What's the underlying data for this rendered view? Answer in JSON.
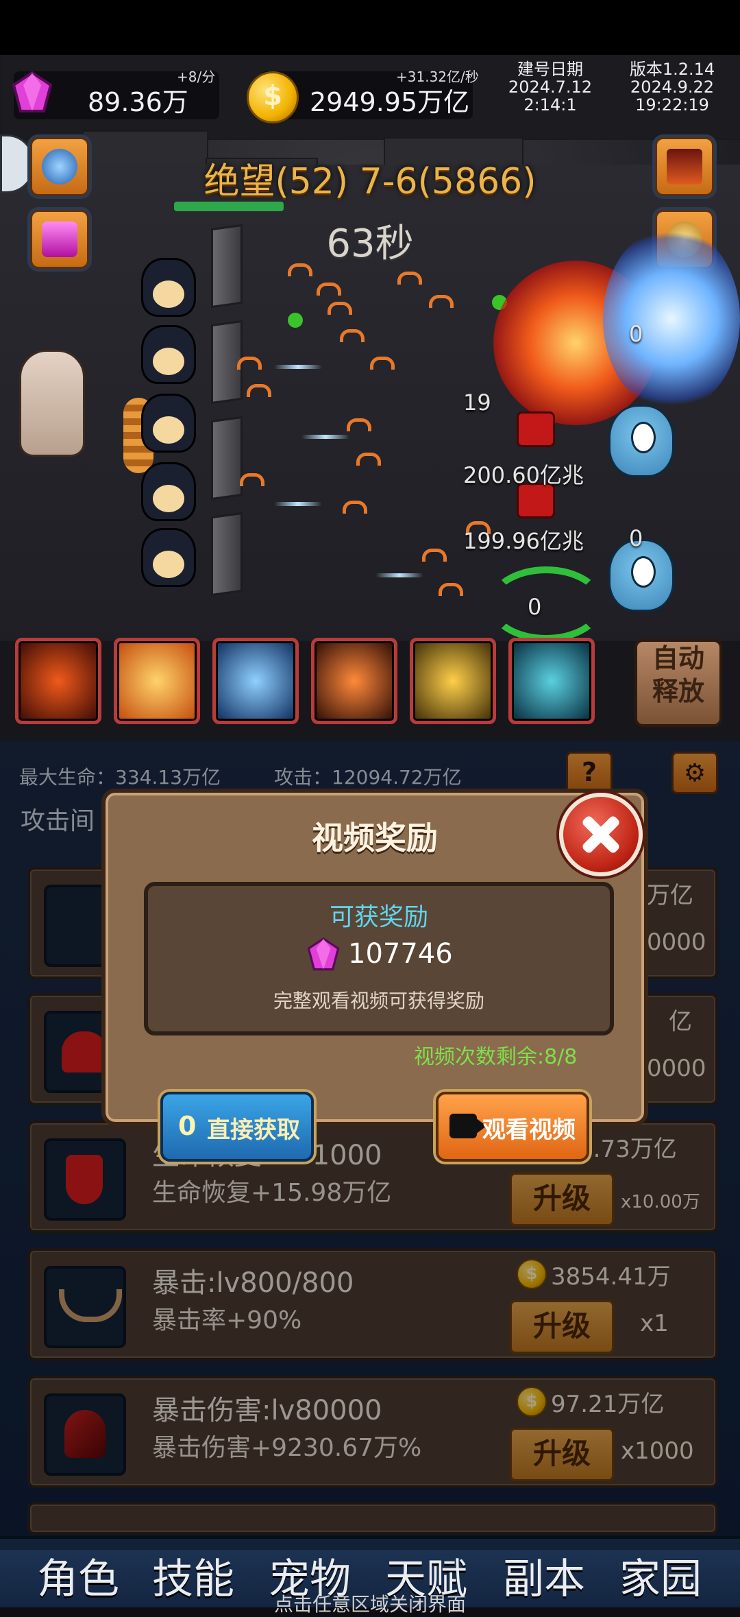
{
  "resources": {
    "gems": "89.36万",
    "gem_rate": "+8/分",
    "coins": "2949.95万亿",
    "coin_rate": "+31.32亿/秒"
  },
  "build_info": {
    "label": "建号日期",
    "date": "2024.7.12",
    "time": "2:14:1"
  },
  "version_info": {
    "label": "版本1.2.14",
    "date": "2024.9.22",
    "time": "19:22:19"
  },
  "stage": {
    "title": "绝望(52) 7-6(5866)",
    "timer": "63秒"
  },
  "damage_numbers": [
    "19",
    "200.60亿兆",
    "199.96亿兆",
    "0",
    "0",
    "0"
  ],
  "auto_button": {
    "line1": "自动",
    "line2": "释放"
  },
  "stats": {
    "max_hp": "最大生命：334.13万亿",
    "attack": "攻击：12094.72万亿",
    "attack_interval": "攻击间",
    "help": "?"
  },
  "upgrades": [
    {
      "name": "",
      "desc": "",
      "cost": "万亿",
      "button": "升级",
      "mult": "0000"
    },
    {
      "name": "",
      "desc": "",
      "cost": "亿",
      "button": "升级",
      "mult": "0000"
    },
    {
      "name": "生命恢复:lv71000",
      "desc": "生命恢复+15.98万亿",
      "cost": "3.73万亿",
      "button": "升级",
      "mult": "x10.00万"
    },
    {
      "name": "暴击:lv800/800",
      "desc": "暴击率+90%",
      "cost": "3854.41万",
      "button": "升级",
      "mult": "x1"
    },
    {
      "name": "暴击伤害:lv80000",
      "desc": "暴击伤害+9230.67万%",
      "cost": "97.21万亿",
      "button": "升级",
      "mult": "x1000"
    }
  ],
  "nav": [
    "角色",
    "技能",
    "宠物",
    "天赋",
    "副本",
    "家园"
  ],
  "hint": "点击任意区域关闭界面",
  "modal": {
    "title": "视频奖励",
    "reward_label": "可获奖励",
    "reward_value": "107746",
    "note": "完整观看视频可获得奖励",
    "remaining": "视频次数剩余:8/8",
    "direct_count": "0",
    "direct_label": "直接获取",
    "watch_label": "观看视频"
  },
  "colors": {
    "stage_title": "#e9b54a",
    "reward_label": "#5fd6f0",
    "remaining": "#7ee04a",
    "upgrade_button": "#e2a04a",
    "close_button": "#c02515"
  },
  "icons": {
    "gem": "gem-icon",
    "coin": "coin-icon",
    "close": "close-icon",
    "video": "video-camera-icon",
    "settings": "gear-icon"
  }
}
